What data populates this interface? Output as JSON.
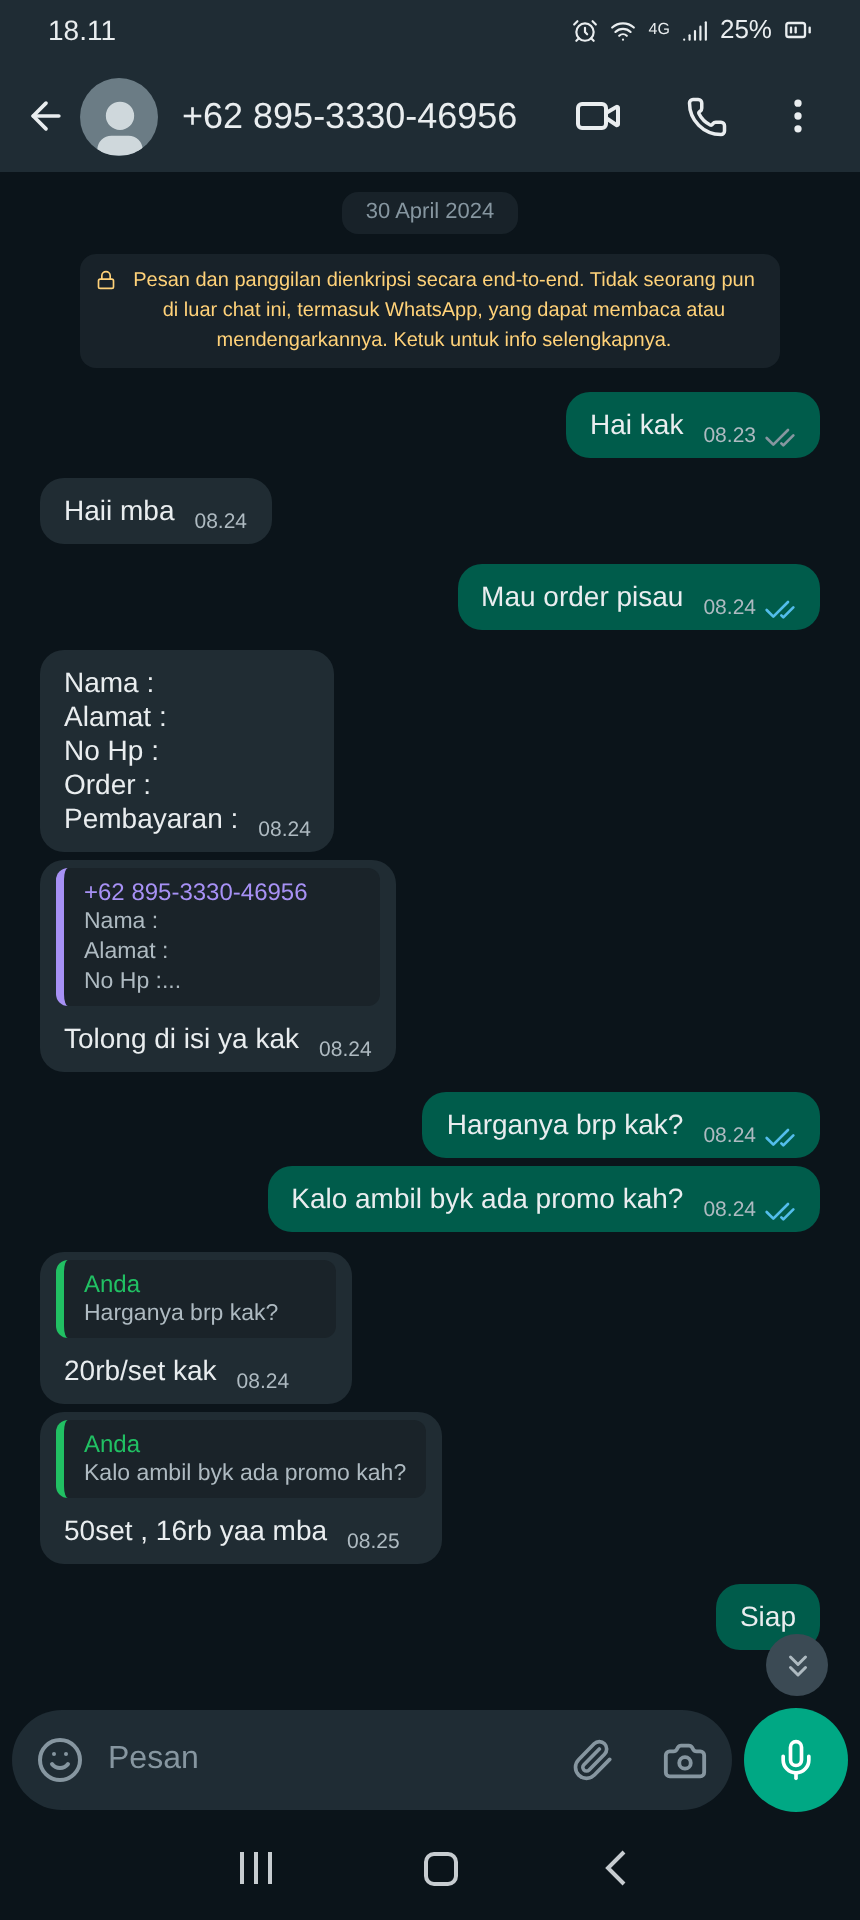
{
  "status_bar": {
    "time": "18.11",
    "network": "4G",
    "battery": "25%"
  },
  "header": {
    "contact": "+62 895-3330-46956"
  },
  "date_chip": "30 April 2024",
  "encryption_notice": "Pesan dan panggilan dienkripsi secara end-to-end. Tidak seorang pun di luar chat ini, termasuk WhatsApp, yang dapat membaca atau mendengarkannya. Ketuk untuk info selengkapnya.",
  "messages": [
    {
      "kind": "out",
      "text": "Hai kak",
      "time": "08.23",
      "read": false
    },
    {
      "kind": "in",
      "text": "Haii mba",
      "time": "08.24"
    },
    {
      "kind": "out",
      "text": "Mau order pisau",
      "time": "08.24",
      "read": true
    },
    {
      "kind": "in",
      "text": "Nama :\nAlamat :\nNo Hp :\nOrder :\nPembayaran :",
      "time": "08.24"
    },
    {
      "kind": "in",
      "quote": {
        "author": "+62 895-3330-46956",
        "color": "#a791f5",
        "text": "Nama :\nAlamat :\nNo Hp :..."
      },
      "text": "Tolong di isi ya kak",
      "time": "08.24"
    },
    {
      "kind": "out",
      "text": "Harganya brp kak?",
      "time": "08.24",
      "read": true
    },
    {
      "kind": "out",
      "text": "Kalo ambil byk ada promo kah?",
      "time": "08.24",
      "read": true
    },
    {
      "kind": "in",
      "quote": {
        "author": "Anda",
        "color": "#21c063",
        "text": "Harganya brp kak?"
      },
      "text": "20rb/set kak",
      "time": "08.24"
    },
    {
      "kind": "in",
      "quote": {
        "author": "Anda",
        "color": "#21c063",
        "text": "Kalo ambil byk ada promo kah?"
      },
      "text": "50set , 16rb yaa mba",
      "time": "08.25"
    },
    {
      "kind": "out",
      "text": "Siap"
    }
  ],
  "composer": {
    "placeholder": "Pesan"
  }
}
